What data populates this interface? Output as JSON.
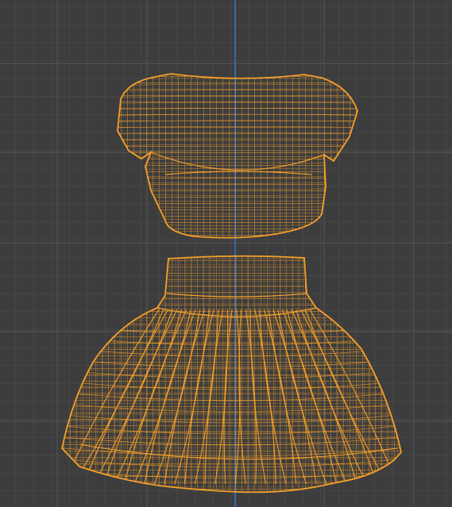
{
  "app": {
    "view": "3D viewport",
    "shading_mode": "wireframe",
    "selection_state": "selected"
  },
  "viewport": {
    "background_color": "#3d3d3d",
    "grid_line_color": "#474747",
    "grid_major_color": "#525252",
    "axis_z_color": "#3b72c8",
    "selection_wire_color": "#f5a02a"
  },
  "scene": {
    "objects": [
      {
        "kind": "crop-top-mesh",
        "icon": "shirt-wireframe-icon",
        "selected": true
      },
      {
        "kind": "skirt-mesh",
        "icon": "skirt-wireframe-icon",
        "selected": true
      }
    ]
  }
}
